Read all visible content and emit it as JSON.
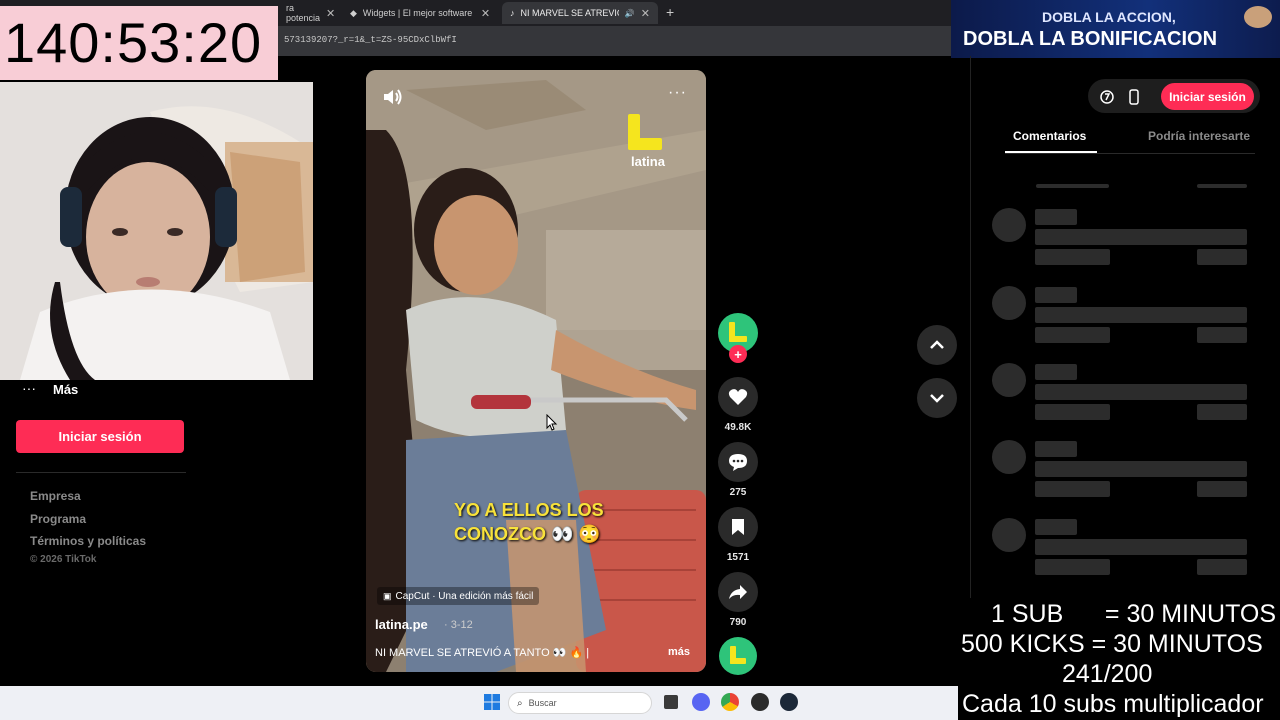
{
  "browser": {
    "tabs": [
      {
        "label": "ra potencia",
        "active": false
      },
      {
        "label": "Widgets | El mejor software para",
        "active": false
      },
      {
        "label": "NI MARVEL SE ATREVIÓ A T",
        "active": true
      }
    ],
    "url_fragment": "573139207?_r=1&_t=ZS-95CDxClbWfI"
  },
  "overlay": {
    "timer": "140:53:20",
    "promo_line1": "DOBLA LA ACCION,",
    "promo_line2": "DOBLA LA BONIFICACION",
    "sub_lines": [
      "1 SUB      = 30 MINUTOS",
      "500 KICKS = 30 MINUTOS",
      "241/200",
      "Cada 10 subs multiplicador"
    ]
  },
  "sidebar": {
    "more_dots": "···",
    "more_label": "Más",
    "login_button": "Iniciar sesión",
    "footer_links": [
      "Empresa",
      "Programa",
      "Términos y políticas"
    ],
    "copyright": "© 2026 TikTok"
  },
  "video": {
    "logo_text": "latina",
    "caption_line1": "YO A ELLOS LOS",
    "caption_line2": "CONOZCO 👀 😳",
    "capcut_label": "CapCut · Una edición más fácil",
    "author": "latina.pe",
    "date": "· 3-12",
    "description": "NI MARVEL SE ATREVIÓ A TANTO 👀 🔥 |",
    "more_link": "más",
    "menu_dots": "···"
  },
  "actions": {
    "likes": "49.8K",
    "comments": "275",
    "saves": "1571",
    "shares": "790"
  },
  "right_panel": {
    "login_button": "Iniciar sesión",
    "tab_comments": "Comentarios",
    "tab_related": "Podría interesarte"
  },
  "taskbar": {
    "search_placeholder": "Buscar"
  },
  "colors": {
    "accent": "#fe2c55",
    "timer_bg": "#f8cdd6",
    "latina_green": "#2ec47a",
    "caption_yellow": "#f8e23a"
  }
}
